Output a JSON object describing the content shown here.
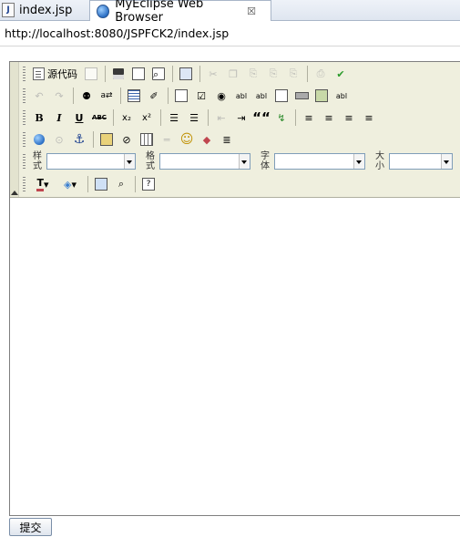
{
  "tabs": [
    {
      "label": "index.jsp",
      "icon": "jsp-file-icon"
    },
    {
      "label": "MyEclipse Web Browser",
      "icon": "web-browser-globe-icon",
      "close_symbol": "☒"
    }
  ],
  "address_bar": {
    "url": "http://localhost:8080/JSPFCK2/index.jsp"
  },
  "editor": {
    "source_label": "源代码",
    "rows": {
      "row1": [
        "source-icon",
        "preview-doc-icon",
        "save-icon",
        "new-page-icon",
        "print-preview-icon",
        "templates-icon",
        "cut-icon",
        "copy-icon",
        "paste-icon",
        "paste-text-icon",
        "paste-word-icon",
        "print-icon",
        "spellcheck-icon"
      ],
      "row2": [
        "undo-icon",
        "redo-icon",
        "find-icon",
        "replace-icon",
        "select-all-icon",
        "remove-format-icon",
        "form-icon",
        "checkbox-icon",
        "radio-icon",
        "text-field-icon",
        "textarea-icon",
        "select-field-icon",
        "button-field-icon",
        "image-button-icon",
        "hidden-field-icon"
      ],
      "row3": [
        "bold-icon",
        "italic-icon",
        "underline-icon",
        "strikethrough-icon",
        "subscript-icon",
        "superscript-icon",
        "ordered-list-icon",
        "unordered-list-icon",
        "outdent-icon",
        "indent-icon",
        "blockquote-icon",
        "div-icon",
        "align-left-icon",
        "align-center-icon",
        "align-right-icon",
        "justify-icon"
      ],
      "row4": [
        "link-icon",
        "unlink-icon",
        "anchor-icon",
        "image-icon",
        "flash-icon",
        "table-icon",
        "horizontal-rule-icon",
        "smiley-icon",
        "special-char-icon",
        "page-break-icon"
      ],
      "row6": [
        "text-color-icon",
        "background-color-icon",
        "maximize-icon",
        "show-blocks-icon",
        "about-icon"
      ]
    },
    "button_glyphs": {
      "bold": "B",
      "italic": "I",
      "underline": "U",
      "strike": "ABC",
      "subscript": "x₂",
      "superscript": "x²",
      "quote": "““"
    },
    "combos": [
      {
        "label": "样式",
        "value": ""
      },
      {
        "label": "格式",
        "value": ""
      },
      {
        "label": "字体",
        "value": ""
      },
      {
        "label": "大小",
        "value": ""
      }
    ]
  },
  "submit_label": "提交",
  "colors": {
    "toolbar_bg": "#efefde",
    "tab_active": "#ffffff",
    "accent": "#2b6fc4"
  }
}
